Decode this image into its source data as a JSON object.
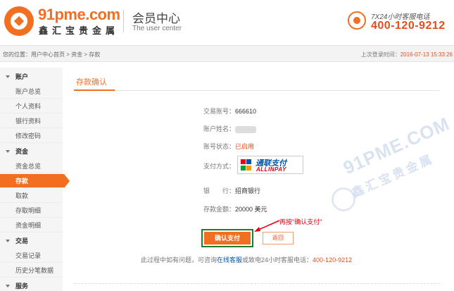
{
  "header": {
    "brand": "91pme.com",
    "brand_cn": "鑫汇宝贵金属",
    "center_title": "会员中心",
    "center_subtitle": "The user center",
    "support_hours": "7X24小时客服电话",
    "support_phone": "400-120-9212"
  },
  "breadcrumb": {
    "text": "您的位置：用户中心首页 > 资金 > 存款",
    "last_login_label": "上次登录时间：",
    "last_login_time": "2016-07-13 15:33:26"
  },
  "sidebar": {
    "groups": [
      {
        "label": "账户",
        "items": [
          "账户总览",
          "个人资料",
          "银行资料",
          "修改密码"
        ]
      },
      {
        "label": "资金",
        "items": [
          "资金总览",
          "存款",
          "取款",
          "存取明细",
          "资金明细"
        ]
      },
      {
        "label": "交易",
        "items": [
          "交易记录",
          "历史分笔数据"
        ]
      },
      {
        "label": "服务"
      }
    ],
    "active_item": "存款"
  },
  "main": {
    "title": "存款确认",
    "account_no_label": "交易账号：",
    "account_no": "666610",
    "account_name_label": "账户姓名：",
    "status_label": "账号状态：",
    "status": "已启用",
    "pay_method_label": "支付方式：",
    "pay_logo_cn": "通联支付",
    "pay_logo_en": "ALLINPAY",
    "bank_label": "银　　行：",
    "bank": "招商银行",
    "amount_label": "存款金额：",
    "amount": "20000 美元",
    "confirm_button": "确认支付",
    "back_button": "返回",
    "annotation": "再按\"确认支付\"",
    "help_prefix": "此过程中如有问题，可咨询",
    "help_link": "在线客服",
    "help_middle": "或致电24小时客服电话：",
    "help_phone": "400-120-9212"
  },
  "watermark": {
    "text": "91PME.COM",
    "text_cn": "鑫汇宝贵金属"
  },
  "colors": {
    "accent": "#f26f21",
    "highlight_border": "#1c7d2c",
    "annotation": "#e60012",
    "link": "#0054a6"
  }
}
